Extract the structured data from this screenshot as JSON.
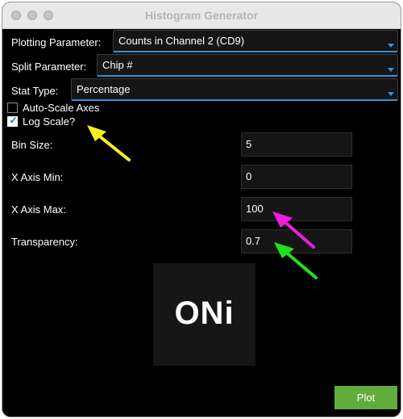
{
  "window": {
    "title": "Histogram Generator"
  },
  "form": {
    "plotting_parameter": {
      "label": "Plotting Parameter:",
      "value": "Counts in Channel 2 (CD9)"
    },
    "split_parameter": {
      "label": "Split Parameter:",
      "value": "Chip #"
    },
    "stat_type": {
      "label": "Stat Type:",
      "value": "Percentage"
    },
    "auto_scale": {
      "label": "Auto-Scale Axes",
      "checked": false
    },
    "log_scale": {
      "label": "Log Scale?",
      "checked": true
    },
    "bin_size": {
      "label": "Bin Size:",
      "value": "5"
    },
    "x_axis_min": {
      "label": "X Axis Min:",
      "value": "0"
    },
    "x_axis_max": {
      "label": "X Axis Max:",
      "value": "100"
    },
    "transparency": {
      "label": "Transparency:",
      "value": "0.7"
    }
  },
  "logo": {
    "text": "ONi"
  },
  "actions": {
    "plot_label": "Plot"
  },
  "annotations": [
    {
      "name": "yellow-arrow",
      "color": "#f5ee1c",
      "points_to": "log_scale"
    },
    {
      "name": "magenta-arrow",
      "color": "#ee1be0",
      "points_to": "x_axis_max"
    },
    {
      "name": "green-arrow",
      "color": "#1ee21e",
      "points_to": "transparency"
    }
  ],
  "colors": {
    "accent": "#3a8fd4",
    "plot_button": "#62ac3c",
    "window_bg": "#000000"
  }
}
